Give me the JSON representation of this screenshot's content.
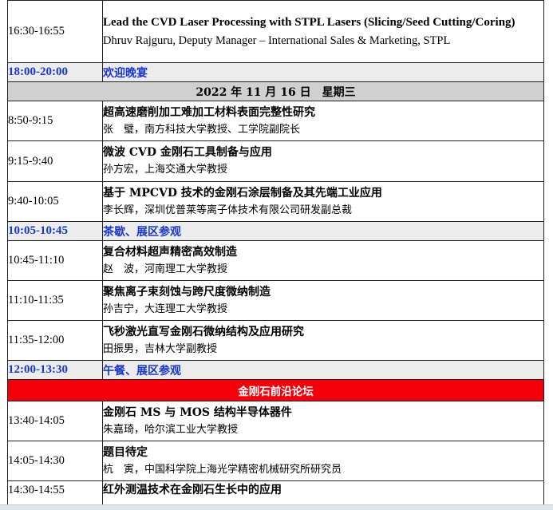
{
  "rows": [
    {
      "kind": "session",
      "time": "16:30-16:55",
      "title": "Lead the CVD Laser Processing with STPL Lasers (Slicing/Seed Cutting/Coring)",
      "speaker": "Dhruv Rajguru, Deputy Manager – International Sales & Marketing, STPL",
      "lang": "en"
    },
    {
      "kind": "break",
      "time": "18:00-20:00",
      "title": "欢迎晚宴"
    },
    {
      "kind": "day",
      "title": "2022 年 11 月 16 日　星期三"
    },
    {
      "kind": "session",
      "time": "8:50-9:15",
      "title": "超高速磨削加工难加工材料表面完整性研究",
      "speaker": "张　璧，南方科技大学教授、工学院副院长"
    },
    {
      "kind": "session",
      "time": "9:15-9:40",
      "title": "微波 CVD 金刚石工具制备与应用",
      "speaker": "孙方宏，上海交通大学教授"
    },
    {
      "kind": "session",
      "time": "9:40-10:05",
      "title": "基于 MPCVD 技术的金刚石涂层制备及其先端工业应用",
      "speaker": "李长辉，深圳优普莱等离子体技术有限公司研发副总裁"
    },
    {
      "kind": "break",
      "time": "10:05-10:45",
      "title": "茶歇、展区参观"
    },
    {
      "kind": "session",
      "time": "10:45-11:10",
      "title": "复合材料超声精密高效制造",
      "speaker": "赵　波，河南理工大学教授"
    },
    {
      "kind": "session",
      "time": "11:10-11:35",
      "title": "聚焦离子束刻蚀与跨尺度微纳制造",
      "speaker": "孙吉宁，大连理工大学教授"
    },
    {
      "kind": "session",
      "time": "11:35-12:00",
      "title": "飞秒激光直写金刚石微纳结构及应用研究",
      "speaker": "田振男，吉林大学副教授"
    },
    {
      "kind": "break",
      "time": "12:00-13:30",
      "title": "午餐、展区参观"
    },
    {
      "kind": "forum",
      "title": "金刚石前沿论坛"
    },
    {
      "kind": "session",
      "time": "13:40-14:05",
      "title": "金刚石 MS 与 MOS 结构半导体器件",
      "speaker": "朱嘉琦，哈尔滨工业大学教授"
    },
    {
      "kind": "session",
      "time": "14:05-14:30",
      "title": "题目待定",
      "speaker": "杭　寅，中国科学院上海光学精密机械研究所研究员"
    },
    {
      "kind": "session",
      "time": "14:30-14:55",
      "title": "红外测温技术在金刚石生长中的应用",
      "speaker": ""
    }
  ]
}
